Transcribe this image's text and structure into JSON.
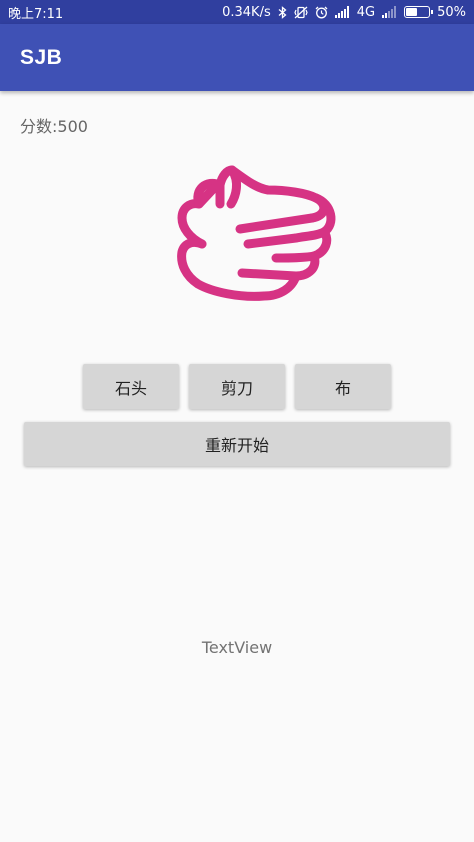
{
  "status_bar": {
    "time": "晚上7:11",
    "net_speed": "0.34K/s",
    "network_type": "4G",
    "battery_percent_text": "50%",
    "battery_level": 0.5
  },
  "app_bar": {
    "title": "SJB"
  },
  "score": {
    "text": "分数:500"
  },
  "hand_image": {
    "icon": "open-hand-icon",
    "color": "#d63384"
  },
  "buttons": {
    "rock": "石头",
    "scissors": "剪刀",
    "paper": "布",
    "restart": "重新开始"
  },
  "result": {
    "text": "TextView"
  },
  "colors": {
    "primary": "#3f51b5",
    "primary_dark": "#303f9f",
    "accent": "#d63384",
    "button": "#d6d6d6"
  }
}
